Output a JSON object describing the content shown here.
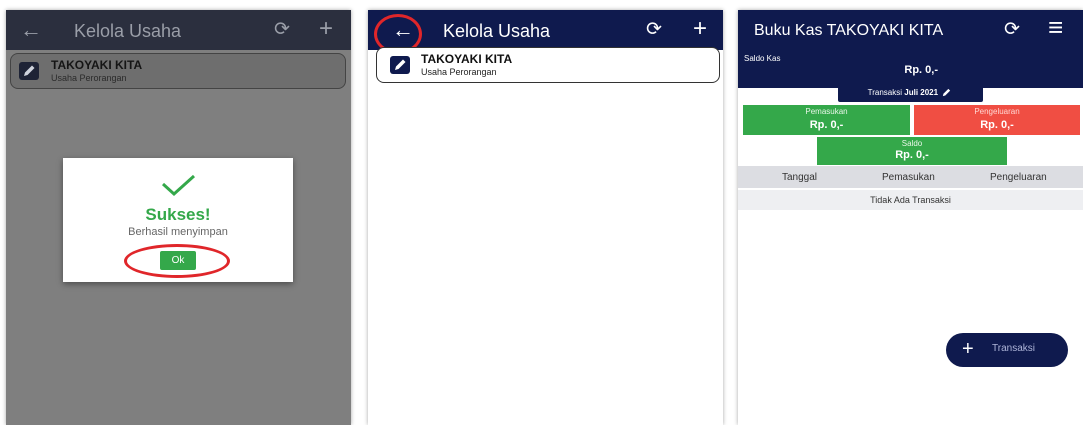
{
  "screen1": {
    "appbar": {
      "title": "Kelola Usaha",
      "back_icon": "←",
      "sync_icon": "⟳",
      "plus_icon": "+"
    },
    "business": {
      "name": "TAKOYAKI KITA",
      "type": "Usaha Perorangan"
    },
    "dialog": {
      "title": "Sukses!",
      "message": "Berhasil menyimpan",
      "ok_label": "Ok"
    }
  },
  "screen2": {
    "appbar": {
      "title": "Kelola Usaha",
      "back_icon": "←",
      "sync_icon": "⟳",
      "plus_icon": "+"
    },
    "business": {
      "name": "TAKOYAKI KITA",
      "type": "Usaha Perorangan"
    }
  },
  "screen3": {
    "appbar": {
      "title": "Buku Kas TAKOYAKI KITA",
      "sync_icon": "⟳",
      "menu_icon": "≡"
    },
    "balance": {
      "label": "Saldo Kas",
      "value": "Rp. 0,-"
    },
    "month": {
      "prefix": "Transaksi",
      "value": "Juli 2021"
    },
    "income": {
      "label": "Pemasukan",
      "value": "Rp. 0,-"
    },
    "expense": {
      "label": "Pengeluaran",
      "value": "Rp. 0,-"
    },
    "saldo": {
      "label": "Saldo",
      "value": "Rp. 0,-"
    },
    "table": {
      "headers": [
        "Tanggal",
        "Pemasukan",
        "Pengeluaran"
      ],
      "empty": "Tidak Ada Transaksi"
    },
    "fab": {
      "label": "Transaksi",
      "icon": "+"
    }
  },
  "colors": {
    "navy": "#0f1a4e",
    "green": "#34a84a",
    "red": "#f04e43",
    "highlight": "#e0262a"
  }
}
